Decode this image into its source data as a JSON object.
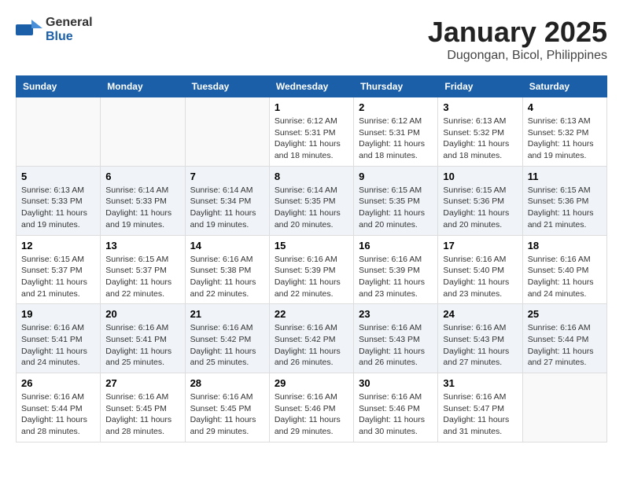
{
  "header": {
    "logo_general": "General",
    "logo_blue": "Blue",
    "month": "January 2025",
    "location": "Dugongan, Bicol, Philippines"
  },
  "days_of_week": [
    "Sunday",
    "Monday",
    "Tuesday",
    "Wednesday",
    "Thursday",
    "Friday",
    "Saturday"
  ],
  "weeks": [
    [
      {
        "day": "",
        "info": ""
      },
      {
        "day": "",
        "info": ""
      },
      {
        "day": "",
        "info": ""
      },
      {
        "day": "1",
        "info": "Sunrise: 6:12 AM\nSunset: 5:31 PM\nDaylight: 11 hours and 18 minutes."
      },
      {
        "day": "2",
        "info": "Sunrise: 6:12 AM\nSunset: 5:31 PM\nDaylight: 11 hours and 18 minutes."
      },
      {
        "day": "3",
        "info": "Sunrise: 6:13 AM\nSunset: 5:32 PM\nDaylight: 11 hours and 18 minutes."
      },
      {
        "day": "4",
        "info": "Sunrise: 6:13 AM\nSunset: 5:32 PM\nDaylight: 11 hours and 19 minutes."
      }
    ],
    [
      {
        "day": "5",
        "info": "Sunrise: 6:13 AM\nSunset: 5:33 PM\nDaylight: 11 hours and 19 minutes."
      },
      {
        "day": "6",
        "info": "Sunrise: 6:14 AM\nSunset: 5:33 PM\nDaylight: 11 hours and 19 minutes."
      },
      {
        "day": "7",
        "info": "Sunrise: 6:14 AM\nSunset: 5:34 PM\nDaylight: 11 hours and 19 minutes."
      },
      {
        "day": "8",
        "info": "Sunrise: 6:14 AM\nSunset: 5:35 PM\nDaylight: 11 hours and 20 minutes."
      },
      {
        "day": "9",
        "info": "Sunrise: 6:15 AM\nSunset: 5:35 PM\nDaylight: 11 hours and 20 minutes."
      },
      {
        "day": "10",
        "info": "Sunrise: 6:15 AM\nSunset: 5:36 PM\nDaylight: 11 hours and 20 minutes."
      },
      {
        "day": "11",
        "info": "Sunrise: 6:15 AM\nSunset: 5:36 PM\nDaylight: 11 hours and 21 minutes."
      }
    ],
    [
      {
        "day": "12",
        "info": "Sunrise: 6:15 AM\nSunset: 5:37 PM\nDaylight: 11 hours and 21 minutes."
      },
      {
        "day": "13",
        "info": "Sunrise: 6:15 AM\nSunset: 5:37 PM\nDaylight: 11 hours and 22 minutes."
      },
      {
        "day": "14",
        "info": "Sunrise: 6:16 AM\nSunset: 5:38 PM\nDaylight: 11 hours and 22 minutes."
      },
      {
        "day": "15",
        "info": "Sunrise: 6:16 AM\nSunset: 5:39 PM\nDaylight: 11 hours and 22 minutes."
      },
      {
        "day": "16",
        "info": "Sunrise: 6:16 AM\nSunset: 5:39 PM\nDaylight: 11 hours and 23 minutes."
      },
      {
        "day": "17",
        "info": "Sunrise: 6:16 AM\nSunset: 5:40 PM\nDaylight: 11 hours and 23 minutes."
      },
      {
        "day": "18",
        "info": "Sunrise: 6:16 AM\nSunset: 5:40 PM\nDaylight: 11 hours and 24 minutes."
      }
    ],
    [
      {
        "day": "19",
        "info": "Sunrise: 6:16 AM\nSunset: 5:41 PM\nDaylight: 11 hours and 24 minutes."
      },
      {
        "day": "20",
        "info": "Sunrise: 6:16 AM\nSunset: 5:41 PM\nDaylight: 11 hours and 25 minutes."
      },
      {
        "day": "21",
        "info": "Sunrise: 6:16 AM\nSunset: 5:42 PM\nDaylight: 11 hours and 25 minutes."
      },
      {
        "day": "22",
        "info": "Sunrise: 6:16 AM\nSunset: 5:42 PM\nDaylight: 11 hours and 26 minutes."
      },
      {
        "day": "23",
        "info": "Sunrise: 6:16 AM\nSunset: 5:43 PM\nDaylight: 11 hours and 26 minutes."
      },
      {
        "day": "24",
        "info": "Sunrise: 6:16 AM\nSunset: 5:43 PM\nDaylight: 11 hours and 27 minutes."
      },
      {
        "day": "25",
        "info": "Sunrise: 6:16 AM\nSunset: 5:44 PM\nDaylight: 11 hours and 27 minutes."
      }
    ],
    [
      {
        "day": "26",
        "info": "Sunrise: 6:16 AM\nSunset: 5:44 PM\nDaylight: 11 hours and 28 minutes."
      },
      {
        "day": "27",
        "info": "Sunrise: 6:16 AM\nSunset: 5:45 PM\nDaylight: 11 hours and 28 minutes."
      },
      {
        "day": "28",
        "info": "Sunrise: 6:16 AM\nSunset: 5:45 PM\nDaylight: 11 hours and 29 minutes."
      },
      {
        "day": "29",
        "info": "Sunrise: 6:16 AM\nSunset: 5:46 PM\nDaylight: 11 hours and 29 minutes."
      },
      {
        "day": "30",
        "info": "Sunrise: 6:16 AM\nSunset: 5:46 PM\nDaylight: 11 hours and 30 minutes."
      },
      {
        "day": "31",
        "info": "Sunrise: 6:16 AM\nSunset: 5:47 PM\nDaylight: 11 hours and 31 minutes."
      },
      {
        "day": "",
        "info": ""
      }
    ]
  ]
}
